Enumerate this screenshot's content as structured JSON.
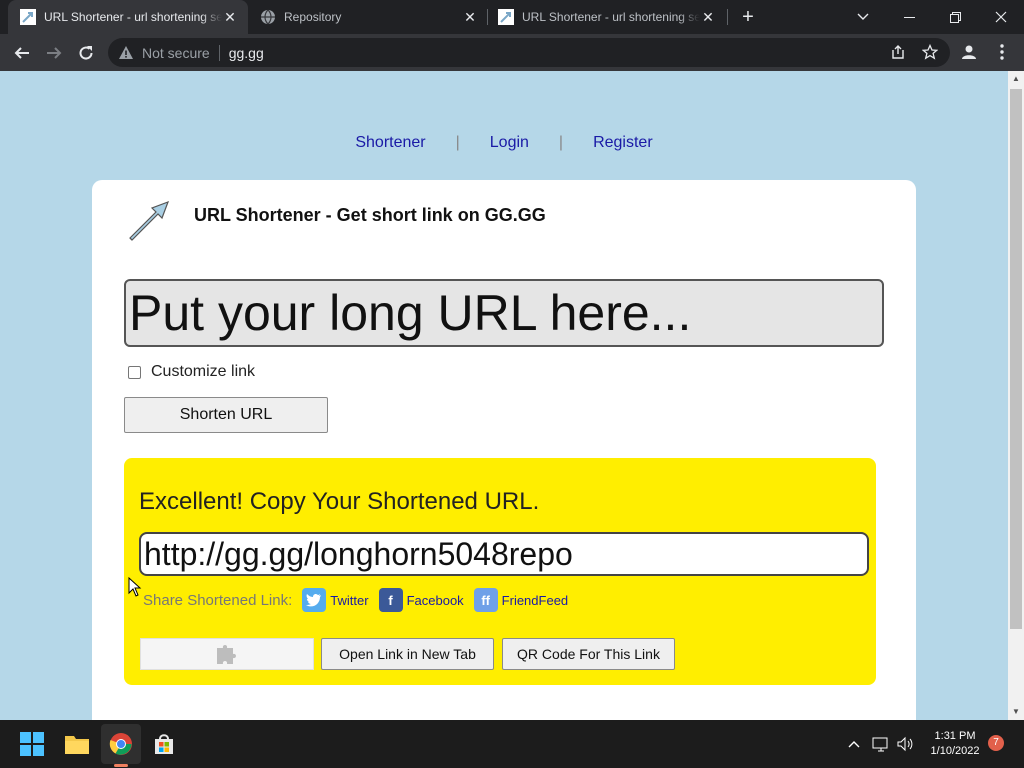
{
  "browser": {
    "tabs": [
      {
        "title": "URL Shortener - url shortening se",
        "active": true
      },
      {
        "title": "Repository",
        "active": false
      },
      {
        "title": "URL Shortener - url shortening se",
        "active": false
      }
    ],
    "new_tab": "+",
    "security_label": "Not secure",
    "address": "gg.gg"
  },
  "page": {
    "nav": [
      {
        "label": "Shortener"
      },
      {
        "label": "Login"
      },
      {
        "label": "Register"
      }
    ],
    "nav_separator": "|",
    "title": "URL Shortener - Get short link on GG.GG",
    "url_input": {
      "value": "",
      "placeholder": "Put your long URL here..."
    },
    "customize_label": "Customize link",
    "customize_checked": false,
    "shorten_button": "Shorten URL",
    "result": {
      "heading": "Excellent! Copy Your Shortened URL.",
      "short_url": "http://gg.gg/longhorn5048repo",
      "share_label": "Share Shortened Link:",
      "share_links": [
        {
          "label": "Twitter",
          "icon": "twitter-icon",
          "color": "#55acee"
        },
        {
          "label": "Facebook",
          "icon": "facebook-icon",
          "color": "#3b5998"
        },
        {
          "label": "FriendFeed",
          "icon": "friendfeed-icon",
          "color": "#6fa0e8"
        }
      ],
      "open_button": "Open Link in New Tab",
      "qr_button": "QR Code For This Link"
    },
    "colors": {
      "background": "#b5d7e8",
      "result_box": "#ffee00",
      "link": "#1a1aa6"
    }
  },
  "taskbar": {
    "apps": [
      "windows-start-icon",
      "file-explorer-icon",
      "chrome-icon",
      "microsoft-store-icon"
    ],
    "time": "1:31 PM",
    "date": "1/10/2022",
    "notifications": "7"
  }
}
